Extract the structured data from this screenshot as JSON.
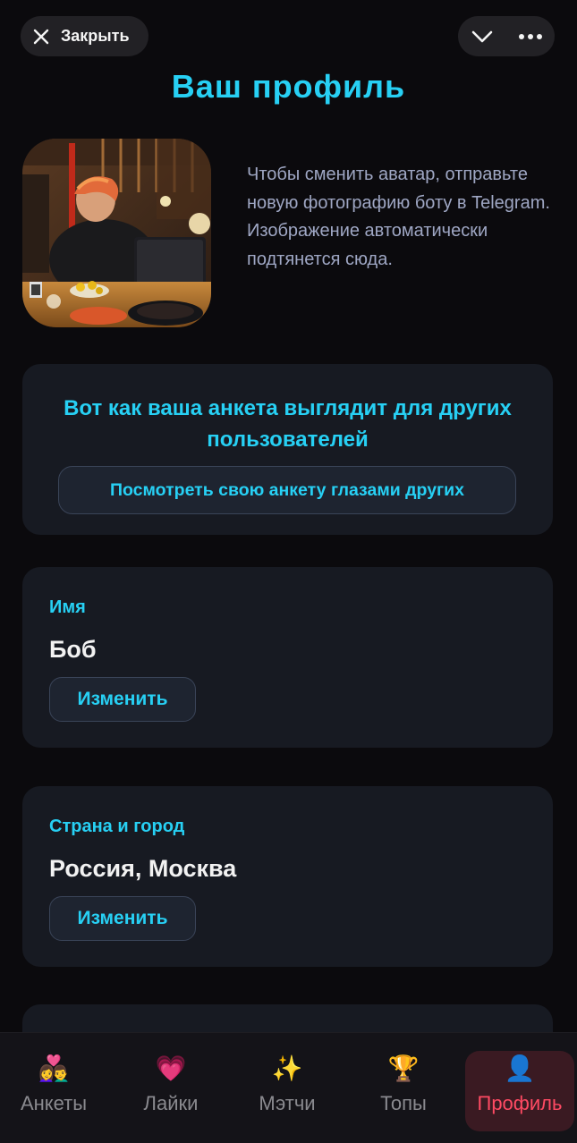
{
  "header": {
    "close_label": "Закрыть"
  },
  "page": {
    "title": "Ваш профиль"
  },
  "avatar": {
    "hint": "Чтобы сменить аватар, отправьте новую фотографию боту в Telegram. Изображение автоматически подтянется сюда."
  },
  "preview": {
    "title": "Вот как ваша анкета выглядит для других пользователей",
    "button_label": "Посмотреть свою анкету глазами других"
  },
  "fields": [
    {
      "label": "Имя",
      "value": "Боб",
      "button_label": "Изменить"
    },
    {
      "label": "Страна и город",
      "value": "Россия, Москва",
      "button_label": "Изменить"
    }
  ],
  "tabs": [
    {
      "icon": "👩‍❤️‍👨",
      "icon_name": "couple-icon",
      "label": "Анкеты"
    },
    {
      "icon": "💗",
      "icon_name": "heart-icon",
      "label": "Лайки"
    },
    {
      "icon": "✨",
      "icon_name": "sparkles-icon",
      "label": "Мэтчи"
    },
    {
      "icon": "🏆",
      "icon_name": "trophy-icon",
      "label": "Топы"
    },
    {
      "icon": "👤",
      "icon_name": "person-icon",
      "label": "Профиль",
      "active": true
    }
  ],
  "colors": {
    "accent": "#27d0f4",
    "active_tab": "#ff4a63",
    "card_bg": "#171a22",
    "page_bg": "#0b0a0d"
  }
}
